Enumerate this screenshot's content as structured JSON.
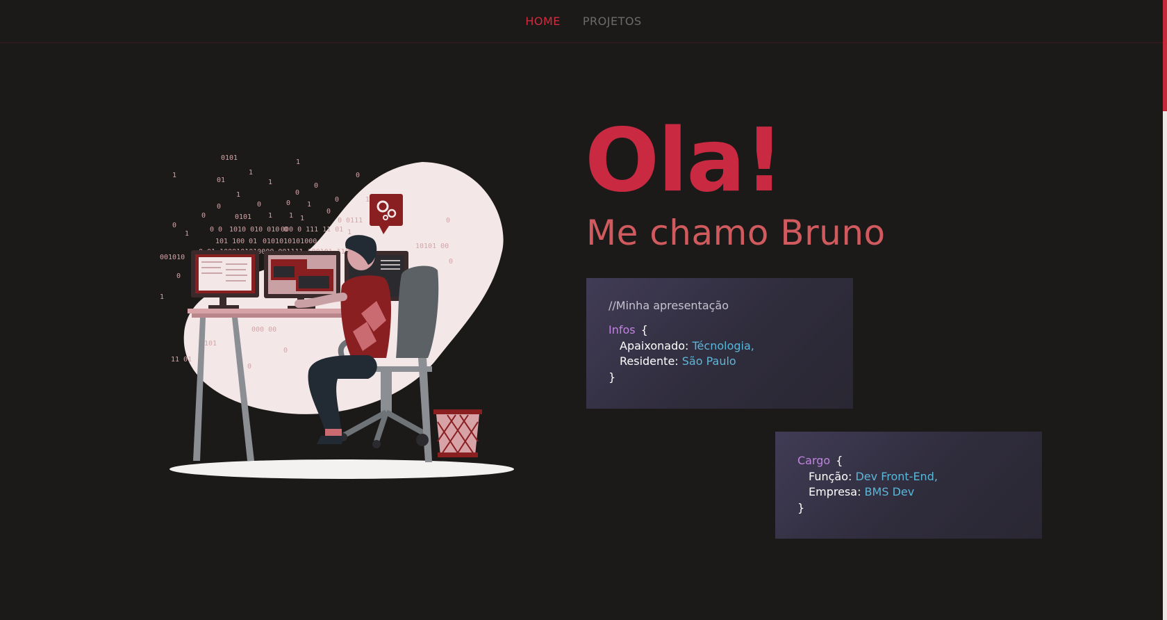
{
  "nav": {
    "items": [
      "HOME",
      "PROJETOS"
    ],
    "active": "HOME"
  },
  "hero": {
    "title": "Ola!",
    "subtitle": "Me chamo Bruno"
  },
  "card1": {
    "comment": "//Minha apresentação",
    "key": "Infos",
    "open": "{",
    "close": "}",
    "rows": [
      {
        "label": "Apaixonado:",
        "value": "Técnologia,"
      },
      {
        "label": "Residente:",
        "value": "São Paulo"
      }
    ]
  },
  "card2": {
    "key": "Cargo",
    "open": "{",
    "close": "}",
    "rows": [
      {
        "label": "Função:",
        "value": "Dev Front-End,"
      },
      {
        "label": "Empresa:",
        "value": "BMS Dev"
      }
    ]
  },
  "illustration": {
    "binary": [
      "0101",
      "1",
      "1",
      "01",
      "1",
      "0",
      "0",
      "1",
      "0",
      "0",
      "1",
      "0",
      "0",
      "1",
      "0",
      "0101",
      "1",
      "1",
      "1",
      "0 0",
      "1010 010 010 0",
      "000 0 111 11 01",
      "101 100 01",
      "0101010101000",
      "0 01 1000101010000 001111 100101 110",
      "001010",
      "0",
      "1",
      "0",
      "0101",
      "0",
      "0",
      "10101 00",
      "0",
      "11 01",
      "0 0111",
      "000 00",
      "110",
      "1"
    ],
    "colors": {
      "accent": "#c92a42",
      "dark": "#8a1f22",
      "blob": "#f3e7e7",
      "chair": "#5c6166",
      "shadow": "#f4f1f1",
      "binary": "#d7a3a6"
    }
  }
}
